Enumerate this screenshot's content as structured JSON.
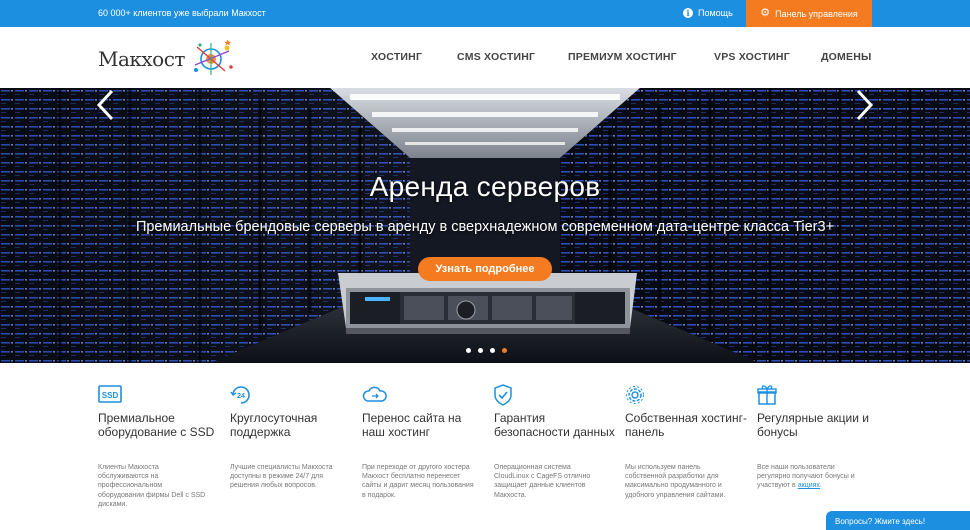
{
  "topbar": {
    "tagline": "60 000+ клиентов уже выбрали Макхост",
    "help_label": "Помощь",
    "panel_label": "Панель управления"
  },
  "logo": {
    "text": "Макхост"
  },
  "nav": [
    {
      "label": "ХОСТИНГ"
    },
    {
      "label": "CMS ХОСТИНГ"
    },
    {
      "label": "ПРЕМИУМ ХОСТИНГ"
    },
    {
      "label": "VPS ХОСТИНГ"
    },
    {
      "label": "ДОМЕНЫ"
    }
  ],
  "hero": {
    "title": "Аренда серверов",
    "subtitle": "Премиальные брендовые серверы в аренду в сверхнадежном современном дата-центре класса Tier3+",
    "button_label": "Узнать подробнее",
    "server_brand": "DELL",
    "slides_count": 4,
    "active_slide": 4
  },
  "features": [
    {
      "icon": "ssd-icon",
      "title": "Премиальное оборудование с SSD",
      "desc": "Клиенты Макхоста обслуживаются на профессиональном оборудовании фирмы Dell с SSD дисками."
    },
    {
      "icon": "clock-24-icon",
      "title": "Круглосуточная поддержка",
      "desc": "Лучшие специалисты Макхоста доступны в режиме 24/7 для решения любых вопросов."
    },
    {
      "icon": "cloud-transfer-icon",
      "title": "Перенос сайта на наш хостинг",
      "desc": "При переходе от другого хостера Макхост бесплатно перенесет сайты и дарит месяц пользования в подарок."
    },
    {
      "icon": "shield-check-icon",
      "title": "Гарантия безопасности данных",
      "desc": "Операционная система CloudLinux с CageFS отлично защищает данные клиентов Макхоста."
    },
    {
      "icon": "gear-icon",
      "title": "Собственная хостинг-панель",
      "desc": "Мы используем панель собственной разработки для максимально продуманного и удобного управления сайтами."
    },
    {
      "icon": "gift-icon",
      "title": "Регулярные акции и бонусы",
      "desc": "Все наши пользователи регулярно получают бонусы и участвуют в ",
      "link": "акциях",
      "desc_end": "."
    }
  ],
  "colors": {
    "accent": "#1d8fe1",
    "brand_orange": "#f47b20"
  },
  "chat": {
    "label": "Вопросы? Жмите здесь!"
  }
}
